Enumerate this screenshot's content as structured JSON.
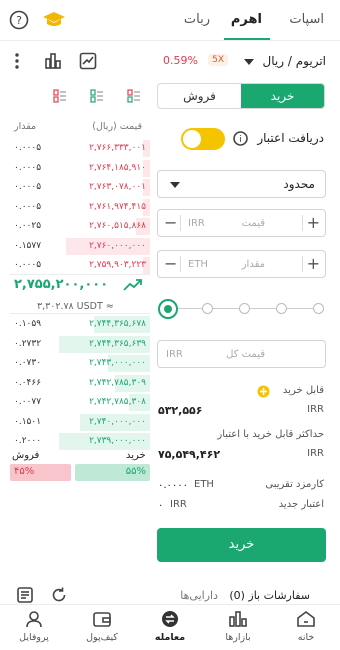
{
  "tabs": [
    {
      "label": "اسپات"
    },
    {
      "label": "اهرم"
    },
    {
      "label": "ربات"
    }
  ],
  "market": {
    "pair": "اتریوم / ریال",
    "leverage": "5X",
    "change": "0.59%"
  },
  "order_side": {
    "buy_label": "خرید",
    "sell_label": "فروش"
  },
  "credit_label": "دریافت اعتبار",
  "order_type": "محدود",
  "price_field": {
    "placeholder": "قیمت",
    "unit": "IRR"
  },
  "amount_field": {
    "placeholder": "مقدار",
    "unit": "ETH"
  },
  "slider_percent": 0,
  "total_field": {
    "placeholder": "قیمت کل",
    "unit": "IRR"
  },
  "available_buy": {
    "label": "قابل خرید",
    "value": "۵۳۲,۵۵۶",
    "unit": "IRR"
  },
  "max_credit": {
    "label": "حداکثر قابل خرید با اعتبار",
    "value": "۷۵,۵۴۹,۴۶۲",
    "unit": "IRR"
  },
  "fee": {
    "label": "کارمزد تقریبی",
    "value": "۰.۰۰۰۰",
    "unit": "ETH"
  },
  "new_credit": {
    "label": "اعتبار جدید",
    "value": "۰",
    "unit": "IRR"
  },
  "submit_label": "خرید",
  "orderbook": {
    "header_price": "قیمت (ریال)",
    "header_amount": "مقدار",
    "asks": [
      {
        "amount": "۰.۰۰۰۵",
        "price": "۲,۷۶۶,۳۳۳,۰۰۱",
        "depth": 0.05
      },
      {
        "amount": "۰.۰۰۰۵",
        "price": "۲,۷۶۴,۱۸۵,۹۱۰",
        "depth": 0.05
      },
      {
        "amount": "۰.۰۰۰۵",
        "price": "۲,۷۶۳,۰۷۸,۰۰۱",
        "depth": 0.05
      },
      {
        "amount": "۰.۰۰۰۵",
        "price": "۲,۷۶۱,۹۷۴,۴۱۵",
        "depth": 0.05
      },
      {
        "amount": "۰.۰۰۲۵",
        "price": "۲,۷۶۰,۵۱۵,۸۶۸",
        "depth": 0.1
      },
      {
        "amount": "۰.۱۵۷۷",
        "price": "۲,۷۶۰,۰۰۰,۰۰۰",
        "depth": 0.6
      },
      {
        "amount": "۰.۰۰۰۵",
        "price": "۲,۷۵۹,۹۰۳,۲۲۳",
        "depth": 0.05
      }
    ],
    "last_price": "۲,۷۵۵,۲۰۰,۰۰۰",
    "usdt_price": "۳,۳۰۲.۷۸ USDT ≈",
    "bids": [
      {
        "amount": "۰.۱۰۵۹",
        "price": "۲,۷۴۴,۳۶۵,۶۷۸",
        "depth": 0.4
      },
      {
        "amount": "۰.۲۷۳۲",
        "price": "۲,۷۴۴,۳۶۵,۶۳۹",
        "depth": 0.65
      },
      {
        "amount": "۰.۰۷۳۰",
        "price": "۲,۷۴۳,۰۰۰,۰۰۰",
        "depth": 0.3
      },
      {
        "amount": "۰.۰۴۶۶",
        "price": "۲,۷۴۲,۷۸۵,۳۰۹",
        "depth": 0.25
      },
      {
        "amount": "۰.۰۰۷۷",
        "price": "۲,۷۴۲,۷۸۵,۳۰۸",
        "depth": 0.15
      },
      {
        "amount": "۰.۱۵۰۱",
        "price": "۲,۷۴۰,۰۰۰,۰۰۰",
        "depth": 0.5
      },
      {
        "amount": "۰.۲۰۰۰",
        "price": "۲,۷۳۹,۰۰۰,۰۰۰",
        "depth": 0.65
      }
    ],
    "ratio": {
      "buy_label": "خرید",
      "sell_label": "فروش",
      "buy_pct": "۵۵%",
      "sell_pct": "۴۵%",
      "buy_fraction": 0.55
    }
  },
  "bottom_section": {
    "open_orders": "سفارشات باز (0)",
    "assets": "دارایی‌ها"
  },
  "nav": [
    {
      "label": "خانه"
    },
    {
      "label": "بازارها"
    },
    {
      "label": "معامله"
    },
    {
      "label": "کیف‌پول"
    },
    {
      "label": "پروفایل"
    }
  ],
  "colors": {
    "accent": "#1ba870",
    "sell": "#e23b4f",
    "credit_toggle": "#f5c400"
  }
}
